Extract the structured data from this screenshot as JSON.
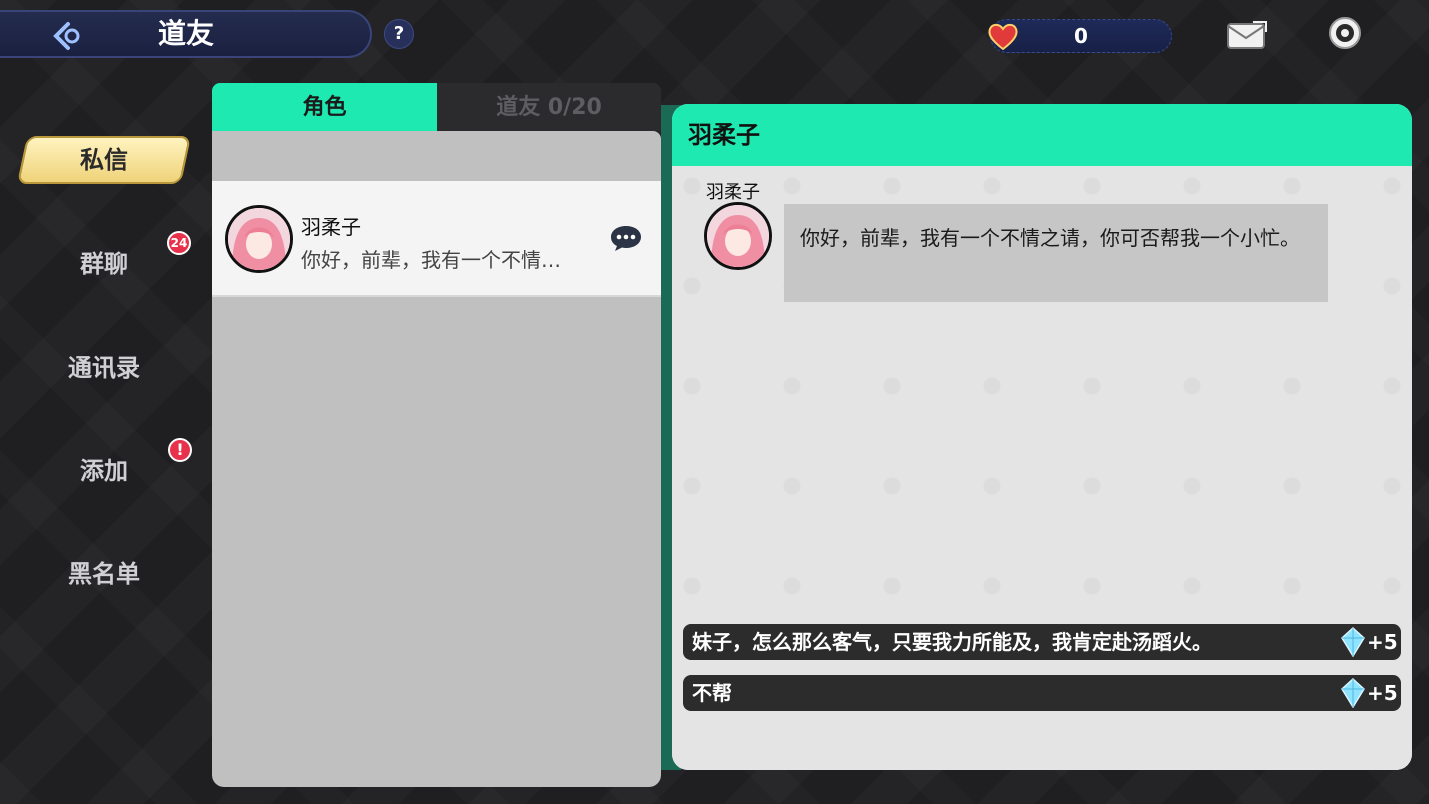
{
  "header": {
    "title": "道友",
    "help_label": "?",
    "hearts_value": "0"
  },
  "nav": {
    "active": "私信",
    "items": [
      "群聊",
      "通讯录",
      "添加",
      "黑名单"
    ],
    "group_badge": "24",
    "add_badge": "!"
  },
  "list": {
    "tabs": {
      "role": "角色",
      "friends": "道友 0/20"
    },
    "rows": [
      {
        "name": "羽柔子",
        "preview": "你好，前辈，我有一个不情…"
      }
    ]
  },
  "chat": {
    "header_name": "羽柔子",
    "sender_name": "羽柔子",
    "message": "你好，前辈，我有一个不情之请，你可否帮我一个小忙。",
    "choices": [
      {
        "text": "妹子，怎么那么客气，只要我力所能及，我肯定赴汤蹈火。",
        "reward": "+5"
      },
      {
        "text": "不帮",
        "reward": "+5"
      }
    ]
  },
  "colors": {
    "accent": "#1de9b0",
    "nav_active": "#efd37a",
    "badge": "#e8314a",
    "topbar": "#1e2a58"
  }
}
